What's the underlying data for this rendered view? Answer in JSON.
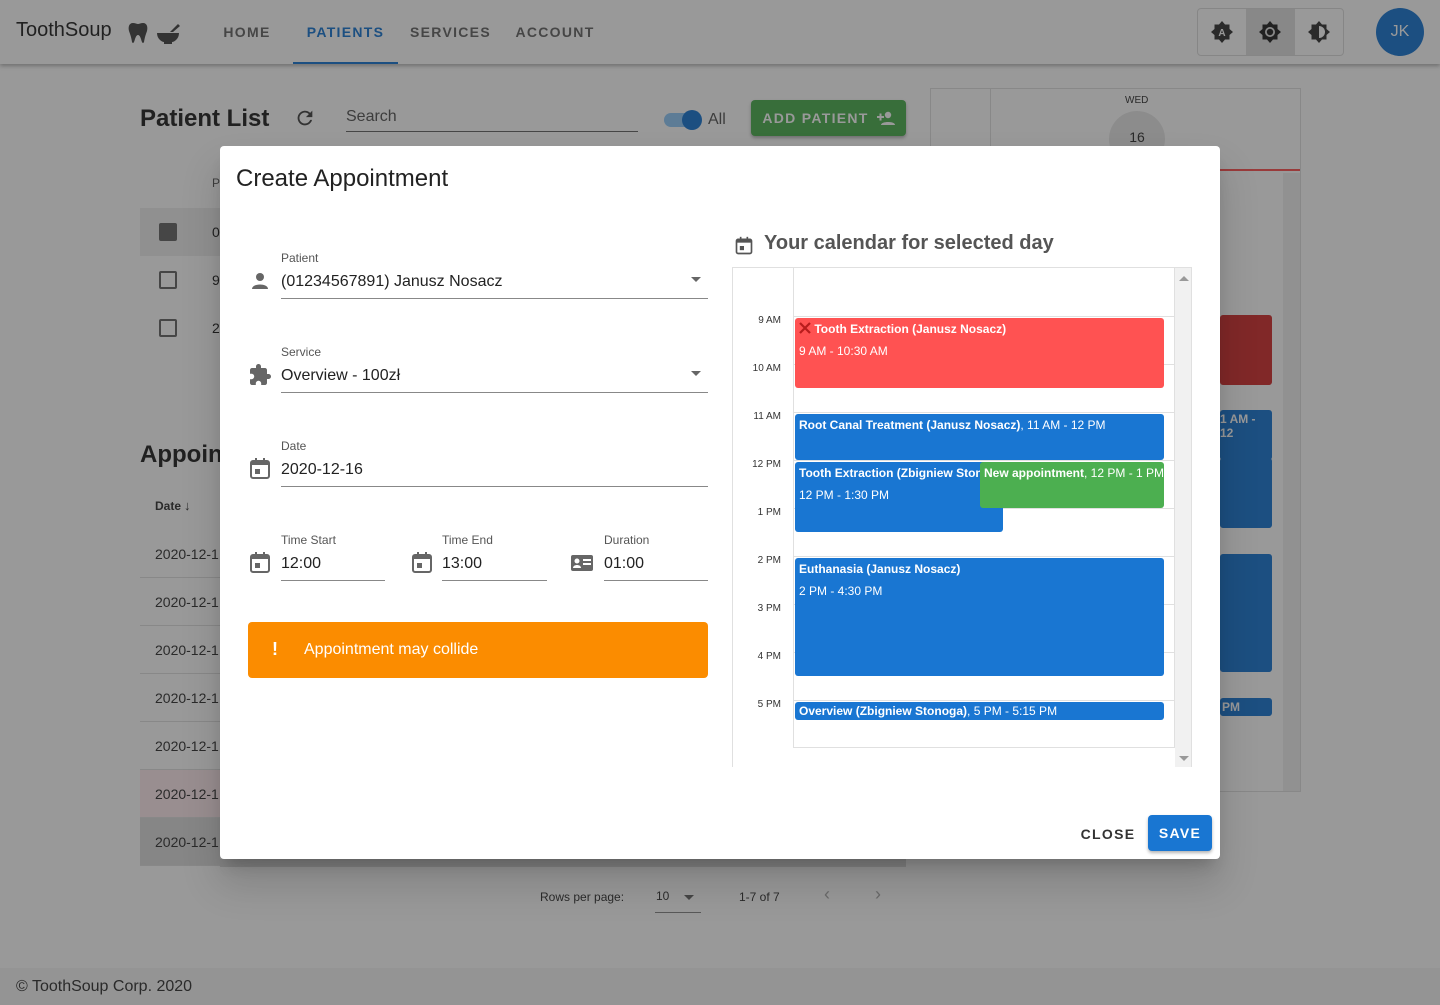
{
  "app": {
    "brand": "ToothSoup",
    "nav": [
      "HOME",
      "PATIENTS",
      "SERVICES",
      "ACCOUNT"
    ],
    "active_nav": "PATIENTS",
    "avatar_initials": "JK",
    "colors": {
      "primary": "#1976d2",
      "success": "#4caf50",
      "warning": "#fb8c00",
      "danger": "#ff5252"
    }
  },
  "background": {
    "patient_list_title": "Patient List",
    "search_placeholder": "Search",
    "toggle_label": "All",
    "add_patient_label": "ADD PATIENT",
    "table_col_header": "P",
    "patient_rows": [
      "0",
      "9",
      "2"
    ],
    "appointments_title": "Appoint",
    "date_col_header": "Date",
    "appointment_rows": [
      "2020-12-1",
      "2020-12-1",
      "2020-12-1",
      "2020-12-1",
      "2020-12-1",
      "2020-12-1",
      "2020-12-1"
    ],
    "rows_per_page_label": "Rows per page:",
    "rows_per_page_value": "10",
    "pagination_text": "1-7 of 7",
    "calendar_day": "WED",
    "calendar_date": "16",
    "partial_event_text_1": "1 AM - 12",
    "partial_event_text_2": "PM"
  },
  "footer": {
    "text": "© ToothSoup Corp. 2020"
  },
  "dialog": {
    "title": "Create Appointment",
    "patient": {
      "label": "Patient",
      "value": "(01234567891) Janusz Nosacz"
    },
    "service": {
      "label": "Service",
      "value": "Overview - 100zł"
    },
    "date": {
      "label": "Date",
      "value": "2020-12-16"
    },
    "time_start": {
      "label": "Time Start",
      "value": "12:00"
    },
    "time_end": {
      "label": "Time End",
      "value": "13:00"
    },
    "duration": {
      "label": "Duration",
      "value": "01:00"
    },
    "alert": {
      "icon": "!",
      "text": "Appointment may collide"
    },
    "calendar_heading": "Your calendar for selected day",
    "time_labels": [
      "9 AM",
      "10 AM",
      "11 AM",
      "12 PM",
      "1 PM",
      "2 PM",
      "3 PM",
      "4 PM",
      "5 PM"
    ],
    "events": [
      {
        "title": "Tooth Extraction (Janusz Nosacz)",
        "time": "9 AM - 10:30 AM",
        "color": "#ff5252"
      },
      {
        "title": "Root Canal Treatment (Janusz Nosacz)",
        "time": ", 11 AM - 12 PM",
        "color": "#1976d2"
      },
      {
        "title": "Tooth Extraction (Zbigniew Stonoga)",
        "time": "12 PM - 1:30 PM",
        "color": "#1976d2"
      },
      {
        "title": "New appointment",
        "time": ", 12 PM - 1 PM",
        "color": "#4caf50"
      },
      {
        "title": "Euthanasia (Janusz Nosacz)",
        "time": "2 PM - 4:30 PM",
        "color": "#1976d2"
      },
      {
        "title": "Overview (Zbigniew Stonoga)",
        "time": ", 5 PM - 5:15 PM",
        "color": "#1976d2"
      }
    ],
    "close_label": "CLOSE",
    "save_label": "SAVE"
  }
}
